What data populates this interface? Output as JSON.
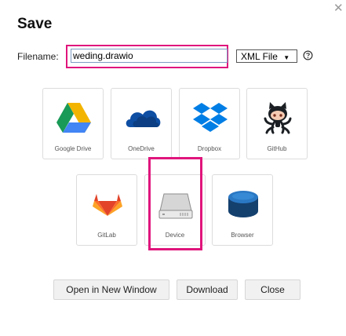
{
  "dialog": {
    "title": "Save"
  },
  "filename": {
    "label": "Filename:",
    "value": "weding.drawio"
  },
  "format": {
    "selected": "XML File",
    "arrow": "▼"
  },
  "icons": {
    "close": "close-icon",
    "help": "help-icon"
  },
  "services_row1": [
    {
      "label": "Google Drive",
      "icon": "google-drive-icon"
    },
    {
      "label": "OneDrive",
      "icon": "onedrive-icon"
    },
    {
      "label": "Dropbox",
      "icon": "dropbox-icon"
    },
    {
      "label": "GitHub",
      "icon": "github-icon"
    }
  ],
  "services_row2": [
    {
      "label": "GitLab",
      "icon": "gitlab-icon"
    },
    {
      "label": "Device",
      "icon": "device-icon",
      "selected": true
    },
    {
      "label": "Browser",
      "icon": "browser-icon"
    }
  ],
  "buttons": {
    "open_new_window": "Open in New Window",
    "download": "Download",
    "close": "Close"
  },
  "colors": {
    "highlight": "#e0157c"
  }
}
